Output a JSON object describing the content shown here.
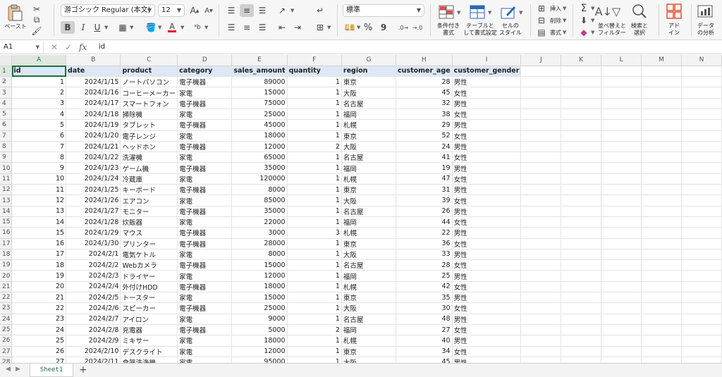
{
  "ribbon": {
    "paste_label": "ペースト",
    "font_name": "游ゴシック Regular (本文)",
    "font_size": "12",
    "grow_font": "A",
    "shrink_font": "A",
    "bold": "B",
    "italic": "I",
    "underline": "U",
    "font_color_letter": "A",
    "number_format": "標準",
    "percent": "%",
    "comma": "9",
    "cond_format_label": "条件付き\n書式",
    "table_format_label": "テーブルと\nして書式設定",
    "cell_style_label": "セルの\nスタイル",
    "insert_label": "挿入",
    "delete_label": "削除",
    "format_label": "書式",
    "sum_symbol": "Σ",
    "sort_filter_label": "並べ替えと\nフィルター",
    "find_select_label": "検索と\n選択",
    "addin_label": "アド\nイン",
    "analyze_label": "データ\nの分析"
  },
  "formula_bar": {
    "name_box": "A1",
    "fx": "fx",
    "content": "id"
  },
  "grid": {
    "columns": [
      "A",
      "B",
      "C",
      "D",
      "E",
      "F",
      "G",
      "H",
      "I",
      "J",
      "K",
      "L",
      "M",
      "N"
    ],
    "rows": [
      [
        "id",
        "date",
        "product",
        "category",
        "sales_amount",
        "quantity",
        "region",
        "customer_age",
        "customer_gender"
      ],
      [
        "1",
        "2024/1/15",
        "ノートパソコン",
        "電子機器",
        "89000",
        "1",
        "東京",
        "28",
        "男性"
      ],
      [
        "2",
        "2024/1/16",
        "コーヒーメーカー",
        "家電",
        "15000",
        "1",
        "大阪",
        "45",
        "女性"
      ],
      [
        "3",
        "2024/1/17",
        "スマートフォン",
        "電子機器",
        "75000",
        "1",
        "名古屋",
        "32",
        "男性"
      ],
      [
        "4",
        "2024/1/18",
        "掃除機",
        "家電",
        "25000",
        "1",
        "福岡",
        "38",
        "女性"
      ],
      [
        "5",
        "2024/1/19",
        "タブレット",
        "電子機器",
        "45000",
        "1",
        "札幌",
        "29",
        "男性"
      ],
      [
        "6",
        "2024/1/20",
        "電子レンジ",
        "家電",
        "18000",
        "1",
        "東京",
        "52",
        "女性"
      ],
      [
        "7",
        "2024/1/21",
        "ヘッドホン",
        "電子機器",
        "12000",
        "2",
        "大阪",
        "24",
        "男性"
      ],
      [
        "8",
        "2024/1/22",
        "洗濯機",
        "家電",
        "65000",
        "1",
        "名古屋",
        "41",
        "女性"
      ],
      [
        "9",
        "2024/1/23",
        "ゲーム機",
        "電子機器",
        "35000",
        "1",
        "福岡",
        "19",
        "男性"
      ],
      [
        "10",
        "2024/1/24",
        "冷蔵庫",
        "家電",
        "120000",
        "1",
        "札幌",
        "47",
        "女性"
      ],
      [
        "11",
        "2024/1/25",
        "キーボード",
        "電子機器",
        "8000",
        "1",
        "東京",
        "31",
        "男性"
      ],
      [
        "12",
        "2024/1/26",
        "エアコン",
        "家電",
        "85000",
        "1",
        "大阪",
        "39",
        "女性"
      ],
      [
        "13",
        "2024/1/27",
        "モニター",
        "電子機器",
        "35000",
        "1",
        "名古屋",
        "26",
        "男性"
      ],
      [
        "14",
        "2024/1/28",
        "炊飯器",
        "家電",
        "22000",
        "1",
        "福岡",
        "44",
        "女性"
      ],
      [
        "15",
        "2024/1/29",
        "マウス",
        "電子機器",
        "3000",
        "3",
        "札幌",
        "22",
        "男性"
      ],
      [
        "16",
        "2024/1/30",
        "プリンター",
        "電子機器",
        "28000",
        "1",
        "東京",
        "36",
        "女性"
      ],
      [
        "17",
        "2024/2/1",
        "電気ケトル",
        "家電",
        "8000",
        "1",
        "大阪",
        "33",
        "男性"
      ],
      [
        "18",
        "2024/2/2",
        "Webカメラ",
        "電子機器",
        "15000",
        "1",
        "名古屋",
        "28",
        "女性"
      ],
      [
        "19",
        "2024/2/3",
        "ドライヤー",
        "家電",
        "12000",
        "1",
        "福岡",
        "25",
        "男性"
      ],
      [
        "20",
        "2024/2/4",
        "外付けHDD",
        "電子機器",
        "18000",
        "1",
        "札幌",
        "42",
        "女性"
      ],
      [
        "21",
        "2024/2/5",
        "トースター",
        "家電",
        "15000",
        "1",
        "東京",
        "35",
        "男性"
      ],
      [
        "22",
        "2024/2/6",
        "スピーカー",
        "電子機器",
        "25000",
        "1",
        "大阪",
        "30",
        "女性"
      ],
      [
        "23",
        "2024/2/7",
        "アイロン",
        "家電",
        "9000",
        "1",
        "名古屋",
        "48",
        "男性"
      ],
      [
        "24",
        "2024/2/8",
        "充電器",
        "電子機器",
        "5000",
        "2",
        "福岡",
        "27",
        "女性"
      ],
      [
        "25",
        "2024/2/9",
        "ミキサー",
        "家電",
        "18000",
        "1",
        "札幌",
        "40",
        "男性"
      ],
      [
        "26",
        "2024/2/10",
        "デスクライト",
        "家電",
        "12000",
        "1",
        "東京",
        "34",
        "女性"
      ],
      [
        "27",
        "2024/2/11",
        "食器洗浄機",
        "家電",
        "95000",
        "1",
        "大阪",
        "45",
        "男性"
      ]
    ]
  },
  "sheets": {
    "active": "Sheet1",
    "add": "+"
  },
  "colors": {
    "accent": "#1d6f42",
    "header_fill": "#dde7f6"
  }
}
